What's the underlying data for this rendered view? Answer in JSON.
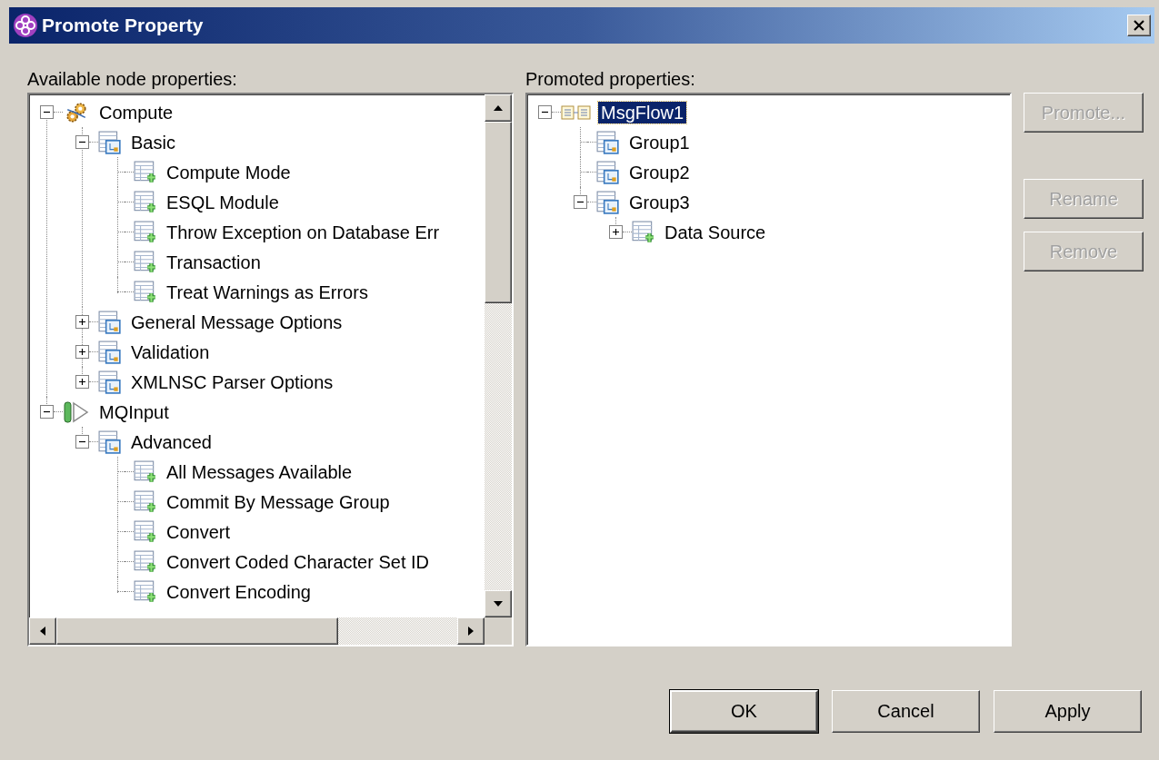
{
  "window": {
    "title": "Promote Property"
  },
  "available": {
    "label": "Available node properties:",
    "items": [
      {
        "label": "Compute",
        "kind": "compute",
        "expanded": true,
        "selected": false,
        "children": [
          {
            "label": "Basic",
            "kind": "group",
            "expanded": true,
            "selected": false,
            "children": [
              {
                "label": "Compute Mode",
                "kind": "property",
                "selected": false
              },
              {
                "label": "ESQL Module",
                "kind": "property",
                "selected": false
              },
              {
                "label": "Throw Exception on Database Err",
                "kind": "property",
                "selected": false
              },
              {
                "label": "Transaction",
                "kind": "property",
                "selected": false
              },
              {
                "label": "Treat Warnings as Errors",
                "kind": "property",
                "selected": false
              }
            ]
          },
          {
            "label": "General Message Options",
            "kind": "group",
            "expanded": false,
            "selected": false
          },
          {
            "label": "Validation",
            "kind": "group",
            "expanded": false,
            "selected": false
          },
          {
            "label": "XMLNSC Parser Options",
            "kind": "group",
            "expanded": false,
            "selected": false
          }
        ]
      },
      {
        "label": "MQInput",
        "kind": "input",
        "expanded": true,
        "selected": false,
        "children": [
          {
            "label": "Advanced",
            "kind": "group",
            "expanded": true,
            "selected": false,
            "children": [
              {
                "label": "All Messages Available",
                "kind": "property",
                "selected": false
              },
              {
                "label": "Commit By Message Group",
                "kind": "property",
                "selected": false
              },
              {
                "label": "Convert",
                "kind": "property",
                "selected": false
              },
              {
                "label": "Convert Coded Character Set ID",
                "kind": "property",
                "selected": false
              },
              {
                "label": "Convert Encoding",
                "kind": "property",
                "selected": false
              }
            ]
          }
        ]
      }
    ]
  },
  "promoted": {
    "label": "Promoted properties:",
    "items": [
      {
        "label": "MsgFlow1",
        "kind": "flow",
        "expanded": true,
        "selected": true,
        "children": [
          {
            "label": "Group1",
            "kind": "group",
            "selected": false
          },
          {
            "label": "Group2",
            "kind": "group",
            "selected": false
          },
          {
            "label": "Group3",
            "kind": "group",
            "expanded": true,
            "selected": false,
            "children": [
              {
                "label": "Data Source",
                "kind": "property",
                "expanded": false,
                "selected": false
              }
            ]
          }
        ]
      }
    ]
  },
  "side_buttons": [
    {
      "label": "Promote...",
      "disabled": true
    },
    {
      "label": "Rename",
      "disabled": true
    },
    {
      "label": "Remove",
      "disabled": true
    }
  ],
  "buttons": [
    {
      "label": "OK",
      "default": true
    },
    {
      "label": "Cancel",
      "default": false
    },
    {
      "label": "Apply",
      "default": false
    }
  ]
}
